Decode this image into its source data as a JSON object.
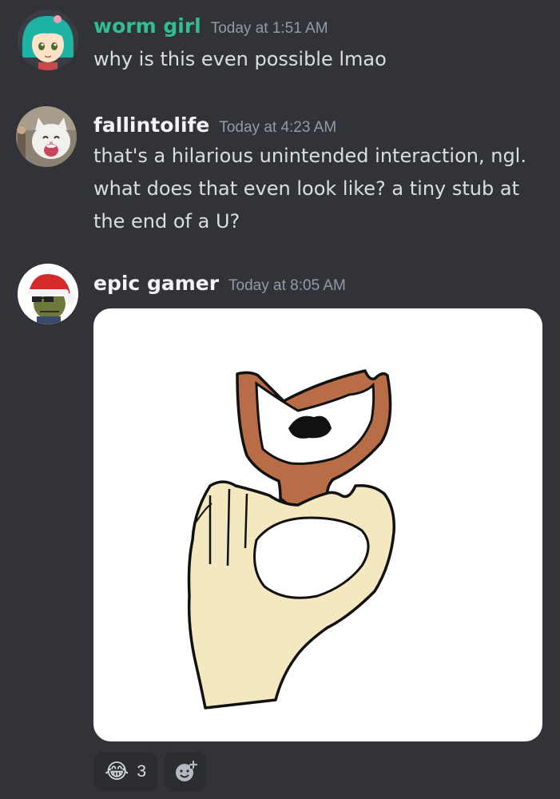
{
  "messages": [
    {
      "username": "worm girl",
      "username_color": "#2fbf95",
      "timestamp": "Today at 1:51 AM",
      "text": "why is this even possible lmao",
      "avatar_icon": "anime-girl-avatar"
    },
    {
      "username": "fallintolife",
      "username_color": "#f2f3f5",
      "timestamp": "Today at 4:23 AM",
      "text": "that's a hilarious unintended interaction, ngl.\nwhat does that even look like? a tiny stub at\nthe end of a U?",
      "avatar_icon": "laughing-cat-avatar"
    },
    {
      "username": "epic gamer",
      "username_color": "#f2f3f5",
      "timestamp": "Today at 8:05 AM",
      "attachment": "drawing-of-hand-holding-y-shaped-object",
      "avatar_icon": "santa-hat-zombie-avatar"
    }
  ],
  "reactions": [
    {
      "emoji": "😂",
      "count": "3",
      "icon": "crying-laughing-emoji"
    },
    {
      "icon": "add-reaction-icon"
    }
  ]
}
